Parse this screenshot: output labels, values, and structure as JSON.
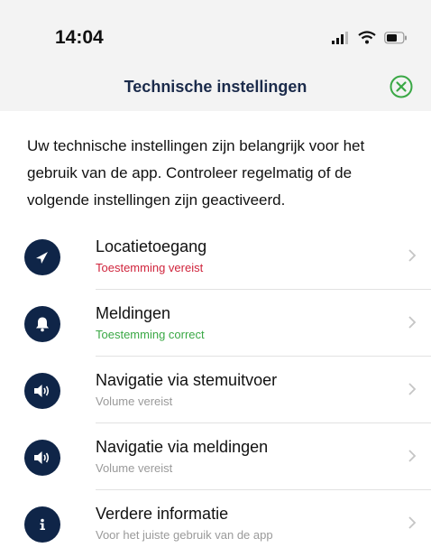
{
  "status_bar": {
    "time": "14:04"
  },
  "header": {
    "title": "Technische instellingen"
  },
  "intro": "Uw technische instellingen zijn belangrijk voor het gebruik van de app. Controleer regelmatig of de volgende instellingen zijn geactiveerd.",
  "settings": [
    {
      "title": "Locatietoegang",
      "subtitle": "Toestemming vereist",
      "subtitle_color": "#d0243c",
      "icon": "location-arrow-icon"
    },
    {
      "title": "Meldingen",
      "subtitle": "Toestemming correct",
      "subtitle_color": "#3aa845",
      "icon": "bell-icon"
    },
    {
      "title": "Navigatie via stemuitvoer",
      "subtitle": "Volume vereist",
      "subtitle_color": "#9a9a9a",
      "icon": "speaker-icon"
    },
    {
      "title": "Navigatie via meldingen",
      "subtitle": "Volume vereist",
      "subtitle_color": "#9a9a9a",
      "icon": "speaker-icon"
    },
    {
      "title": "Verdere informatie",
      "subtitle": "Voor het juiste gebruik van de app",
      "subtitle_color": "#9a9a9a",
      "icon": "info-icon"
    }
  ],
  "colors": {
    "icon_bg": "#0f2548",
    "title_color": "#1b2b4b",
    "close_color": "#3aa845"
  }
}
